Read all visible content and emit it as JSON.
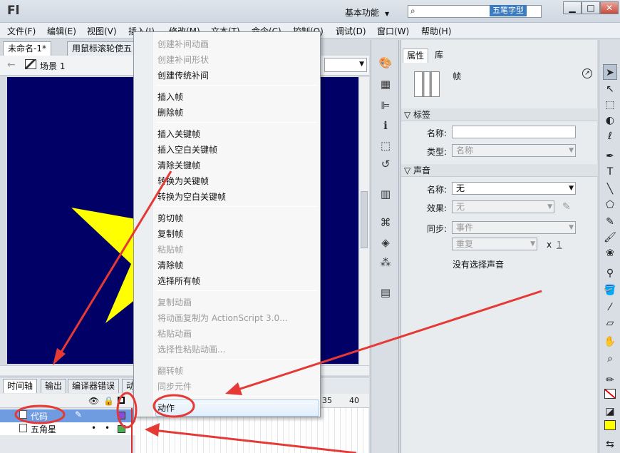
{
  "app": {
    "logo": "Fl",
    "workspace": "基本功能",
    "watermark": "五笔字型"
  },
  "window": {
    "minimize": "▁",
    "maximize": "□",
    "close": "✕"
  },
  "menu": [
    "文件(F)",
    "编辑(E)",
    "视图(V)",
    "插入(I)",
    "修改(M)",
    "文本(T)",
    "命令(C)",
    "控制(O)",
    "调试(D)",
    "窗口(W)",
    "帮助(H)"
  ],
  "tabs": {
    "doc1": "未命名-1*",
    "doc2": "用鼠标滚轮使五"
  },
  "editbar": {
    "scene": "场景 1"
  },
  "timeline": {
    "tabs": [
      "时间轴",
      "输出",
      "编译器错误",
      "动"
    ],
    "ruler": [
      "35",
      "40"
    ],
    "layers": [
      {
        "name": "代码"
      },
      {
        "name": "五角星"
      }
    ]
  },
  "context_menu": {
    "groups": [
      [
        {
          "label": "创建补间动画",
          "enabled": false
        },
        {
          "label": "创建补间形状",
          "enabled": false
        },
        {
          "label": "创建传统补间",
          "enabled": true
        }
      ],
      [
        {
          "label": "插入帧",
          "enabled": true
        },
        {
          "label": "删除帧",
          "enabled": true
        }
      ],
      [
        {
          "label": "插入关键帧",
          "enabled": true
        },
        {
          "label": "插入空白关键帧",
          "enabled": true
        },
        {
          "label": "清除关键帧",
          "enabled": true
        },
        {
          "label": "转换为关键帧",
          "enabled": true
        },
        {
          "label": "转换为空白关键帧",
          "enabled": true
        }
      ],
      [
        {
          "label": "剪切帧",
          "enabled": true
        },
        {
          "label": "复制帧",
          "enabled": true
        },
        {
          "label": "粘贴帧",
          "enabled": false
        },
        {
          "label": "清除帧",
          "enabled": true
        },
        {
          "label": "选择所有帧",
          "enabled": true
        }
      ],
      [
        {
          "label": "复制动画",
          "enabled": false
        },
        {
          "label": "将动画复制为 ActionScript 3.0...",
          "enabled": false
        },
        {
          "label": "粘贴动画",
          "enabled": false
        },
        {
          "label": "选择性粘贴动画...",
          "enabled": false
        }
      ],
      [
        {
          "label": "翻转帧",
          "enabled": false
        },
        {
          "label": "同步元件",
          "enabled": false
        }
      ],
      [
        {
          "label": "动作",
          "enabled": true
        }
      ]
    ]
  },
  "properties": {
    "tabs": [
      "属性",
      "库"
    ],
    "selection": "帧",
    "label_section": "标签",
    "name_label": "名称:",
    "name_value": "",
    "type_label": "类型:",
    "type_value": "名称",
    "sound_section": "声音",
    "sound_name_label": "名称:",
    "sound_name_value": "无",
    "effect_label": "效果:",
    "effect_value": "无",
    "sync_label": "同步:",
    "sync_value": "事件",
    "repeat_value": "重复",
    "x_label": "x",
    "repeat_count": "1",
    "no_sound": "没有选择声音"
  },
  "colors": {
    "stage": "#000066",
    "star": "#ffff00",
    "highlight_layer": "#6f9be0",
    "annotation": "#e53935"
  }
}
